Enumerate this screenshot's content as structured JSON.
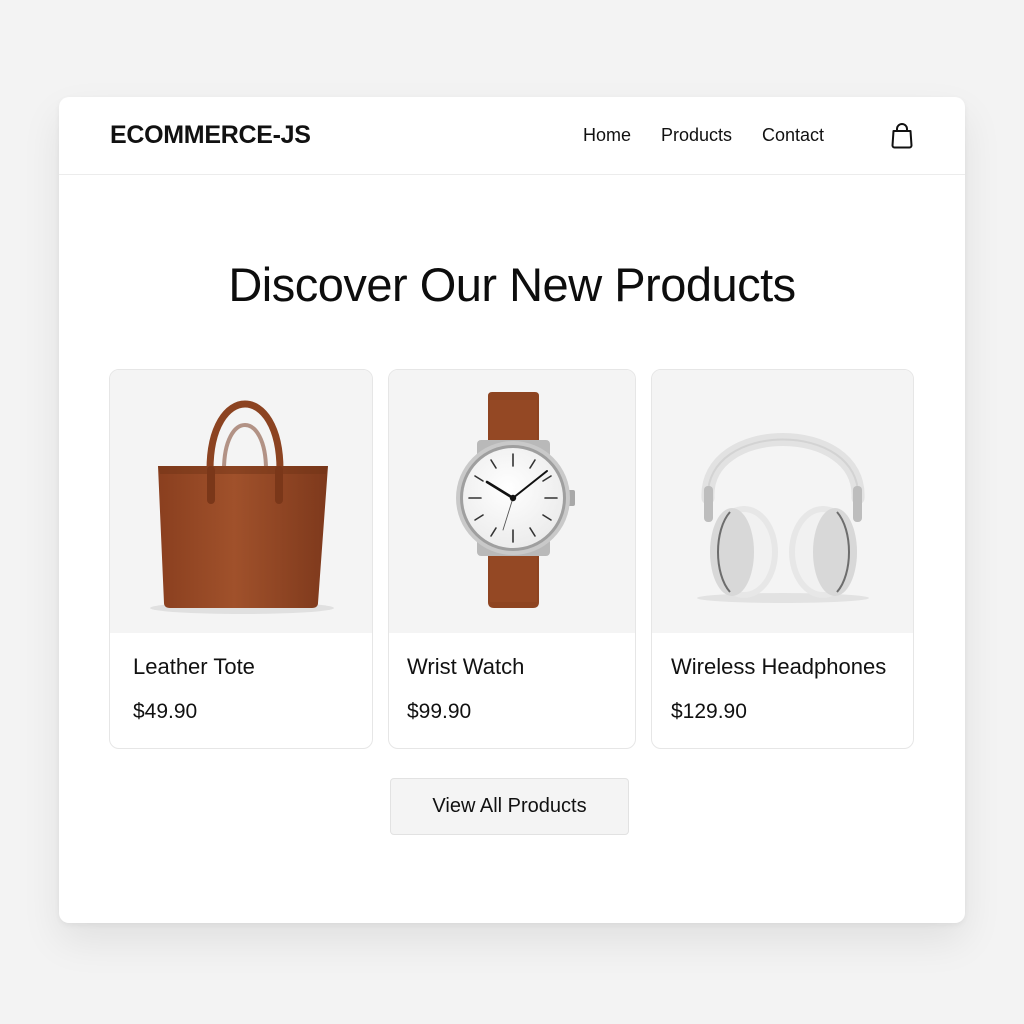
{
  "header": {
    "brand": "ECOMMERCE-JS",
    "nav": [
      "Home",
      "Products",
      "Contact"
    ],
    "cart_icon": "shopping-bag-icon"
  },
  "hero": {
    "title": "Discover Our New Products"
  },
  "products": [
    {
      "name": "Leather Tote",
      "price": "$49.90",
      "image": "leather-tote-bag"
    },
    {
      "name": "Wrist Watch",
      "price": "$99.90",
      "image": "wrist-watch"
    },
    {
      "name": "Wireless Headphones",
      "price": "$129.90",
      "image": "wireless-headphones"
    }
  ],
  "cta": {
    "view_all_label": "View All Products"
  },
  "colors": {
    "background": "#f3f3f3",
    "surface": "#ffffff",
    "text": "#111111",
    "leather": "#9a4a26"
  }
}
